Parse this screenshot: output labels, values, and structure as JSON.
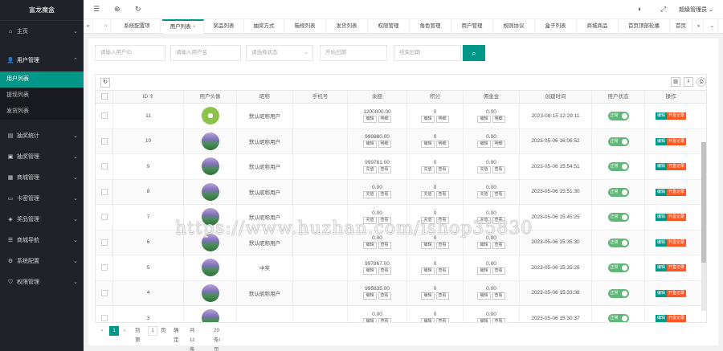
{
  "sidebar": {
    "logo": "富龙魔盒",
    "items": [
      {
        "label": "主页",
        "icon": "home-icon"
      },
      {
        "label": "用户管理",
        "icon": "user-icon"
      },
      {
        "label": "抽奖统计",
        "icon": "chart-icon"
      },
      {
        "label": "抽奖管理",
        "icon": "gift-icon"
      },
      {
        "label": "商城管理",
        "icon": "shop-icon"
      },
      {
        "label": "卡密管理",
        "icon": "card-icon"
      },
      {
        "label": "奖品管理",
        "icon": "prize-icon"
      },
      {
        "label": "商城导航",
        "icon": "nav-icon"
      },
      {
        "label": "系统配置",
        "icon": "gear-icon"
      },
      {
        "label": "权限管理",
        "icon": "shield-icon"
      }
    ],
    "subitems": [
      "用户列表",
      "提现列表",
      "发货列表"
    ]
  },
  "topbar": {
    "user": "超级管理员"
  },
  "tabs": [
    "系统配置项",
    "用户列表",
    "奖品列表",
    "抽奖方式",
    "箱规列表",
    "发货列表",
    "权限管理",
    "角色管理",
    "用户管理",
    "规则协议",
    "盒子列表",
    "商城商品",
    "首页顶部轮播",
    "首页"
  ],
  "search": {
    "p1": "请输入用户ID",
    "p2": "请输入用户名",
    "p3": "请选择状态",
    "p4": "开始日期",
    "p5": "结束日期"
  },
  "table": {
    "headers": [
      "ID",
      "用户头像",
      "昵称",
      "手机号",
      "余额",
      "积分",
      "佣金金",
      "创建时间",
      "用户状态",
      "操作"
    ],
    "sort_mark": "⇕",
    "status_label": "正常",
    "op_a": "编辑",
    "op_b": "开盒记录",
    "rows": [
      {
        "id": "11",
        "avatar": "green",
        "nick": "默认昵称用户",
        "balance": "1200000.00",
        "points": "0",
        "comm": "0.00",
        "time": "2023-08-15 12:29:11",
        "btns": [
          "编辑",
          "明细"
        ]
      },
      {
        "id": "10",
        "avatar": "purple",
        "nick": "默认昵称用户",
        "balance": "999880.00",
        "points": "0",
        "comm": "0.00",
        "time": "2023-05-06 16:06:52",
        "btns": [
          "编辑",
          "明细"
        ]
      },
      {
        "id": "9",
        "avatar": "purple",
        "nick": "默认昵称用户",
        "balance": "999761.00",
        "points": "0",
        "comm": "0.00",
        "time": "2023-05-06 15:54:51",
        "btns": [
          "充值",
          "查看"
        ]
      },
      {
        "id": "8",
        "avatar": "purple",
        "nick": "默认昵称用户",
        "balance": "0.00",
        "points": "0",
        "comm": "0.00",
        "time": "2023-05-06 15:51:30",
        "btns": [
          "充值",
          "查看"
        ]
      },
      {
        "id": "7",
        "avatar": "purple",
        "nick": "默认昵称用户",
        "balance": "0.00",
        "points": "0",
        "comm": "0.00",
        "time": "2023-05-06 15:45:25",
        "btns": [
          "充值",
          "查看"
        ]
      },
      {
        "id": "6",
        "avatar": "purple",
        "nick": "默认昵称用户",
        "balance": "0.00",
        "points": "0",
        "comm": "0.00",
        "time": "2023-05-06 15:35:30",
        "btns": [
          "编辑",
          "查看"
        ]
      },
      {
        "id": "5",
        "avatar": "purple",
        "nick": "中奖",
        "balance": "997867.00",
        "points": "0",
        "comm": "0.00",
        "time": "2023-05-06 15:35:26",
        "btns": [
          "编辑",
          "查看"
        ]
      },
      {
        "id": "4",
        "avatar": "purple",
        "nick": "默认昵称用户",
        "balance": "995835.00",
        "points": "0",
        "comm": "0.00",
        "time": "2023-05-06 15:33:38",
        "btns": [
          "编辑",
          "查看"
        ]
      },
      {
        "id": "3",
        "avatar": "purple",
        "nick": "",
        "balance": "0.00",
        "points": "0",
        "comm": "0.00",
        "time": "2023-05-06 15:30:37",
        "btns": [
          "编辑",
          "查看"
        ]
      }
    ]
  },
  "pager": {
    "current": "1",
    "goto_label": "到第",
    "page_input": "1",
    "page_unit": "页",
    "confirm": "确定",
    "total": "共 11 条",
    "per_page": "20 条/页"
  },
  "watermark": "https://www.huzhan.com/ishop35830"
}
